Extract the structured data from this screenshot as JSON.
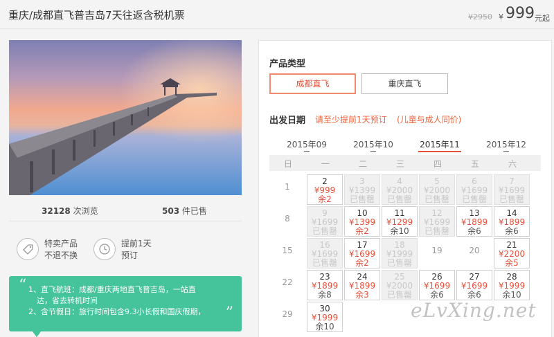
{
  "header": {
    "title": "重庆/成都直飞普吉岛7天往返含税机票",
    "price_old": "¥2950",
    "price_symbol": "¥",
    "price": "999",
    "price_unit": "元起"
  },
  "stats": {
    "views_count": "32128",
    "views_label": "次浏览",
    "sold_count": "503",
    "sold_label": "件已售"
  },
  "features": [
    {
      "line1": "特卖产品",
      "line2": "不退不换",
      "icon": "tag-icon"
    },
    {
      "line1": "提前1天",
      "line2": "预订",
      "icon": "clock-icon"
    }
  ],
  "notes": {
    "line1": "1、直飞航班：成都/重庆两地直飞普吉岛，一站直",
    "line2": "达，省去转机时间",
    "line3": "2、含节假日：旅行时间包含9.3小长假和国庆假期，"
  },
  "booking": {
    "type_label": "产品类型",
    "types": [
      "成都直飞",
      "重庆直飞"
    ],
    "date_label": "出发日期",
    "hint1": "请至少提前1天预订",
    "hint2": "(儿童与成人同价)",
    "months": [
      "2015年09",
      "2015年10",
      "2015年11",
      "2015年12"
    ],
    "weekdays": [
      "日",
      "一",
      "二",
      "三",
      "四",
      "五",
      "六"
    ],
    "rows": [
      [
        {
          "d": "1",
          "s": "bare"
        },
        {
          "d": "2",
          "s": "first",
          "p": "¥999",
          "t": "余2"
        },
        {
          "d": "3",
          "s": "sold",
          "p": "¥1399",
          "t": "已售罄"
        },
        {
          "d": "4",
          "s": "sold",
          "p": "¥2000",
          "t": "已售罄"
        },
        {
          "d": "5",
          "s": "sold",
          "p": "¥2000",
          "t": "已售罄"
        },
        {
          "d": "6",
          "s": "sold",
          "p": "¥1699",
          "t": "已售罄"
        },
        {
          "d": "7",
          "s": "sold",
          "p": "¥1699",
          "t": "已售罄"
        }
      ],
      [
        {
          "d": "8",
          "s": "bare"
        },
        {
          "d": "9",
          "s": "sold",
          "p": "¥1699",
          "t": "已售罄"
        },
        {
          "d": "10",
          "s": "red",
          "p": "¥1399",
          "t": "余2"
        },
        {
          "d": "11",
          "s": "avail",
          "p": "¥1299",
          "t": "余10"
        },
        {
          "d": "12",
          "s": "sold",
          "p": "¥1699",
          "t": "已售罄"
        },
        {
          "d": "13",
          "s": "avail",
          "p": "¥1899",
          "t": "余6"
        },
        {
          "d": "14",
          "s": "avail",
          "p": "¥1899",
          "t": "余6"
        }
      ],
      [
        {
          "d": "15",
          "s": "bare"
        },
        {
          "d": "16",
          "s": "sold",
          "p": "¥1699",
          "t": "已售罄"
        },
        {
          "d": "17",
          "s": "red",
          "p": "¥1699",
          "t": "余2"
        },
        {
          "d": "18",
          "s": "sold",
          "p": "¥1999",
          "t": "已售罄"
        },
        {
          "d": "19",
          "s": "bare"
        },
        {
          "d": "20",
          "s": "bare"
        },
        {
          "d": "21",
          "s": "red",
          "p": "¥2200",
          "t": "余5"
        }
      ],
      [
        {
          "d": "22",
          "s": "bare"
        },
        {
          "d": "23",
          "s": "avail",
          "p": "¥1899",
          "t": "余8"
        },
        {
          "d": "24",
          "s": "red",
          "p": "¥1899",
          "t": "余3"
        },
        {
          "d": "25",
          "s": "sold",
          "p": "¥2000",
          "t": "已售罄"
        },
        {
          "d": "26",
          "s": "avail",
          "p": "¥1699",
          "t": "余6"
        },
        {
          "d": "27",
          "s": "avail",
          "p": "¥1699",
          "t": "余6"
        },
        {
          "d": "28",
          "s": "avail",
          "p": "¥1999",
          "t": "余10"
        }
      ],
      [
        {
          "d": "29",
          "s": "bare"
        },
        {
          "d": "30",
          "s": "avail",
          "p": "¥1999",
          "t": "余10"
        }
      ]
    ]
  },
  "watermark": "eLvXing.net",
  "colors": {
    "accent": "#e4503a",
    "green": "#45c39a",
    "sold_bg": "#f0f0f0"
  }
}
